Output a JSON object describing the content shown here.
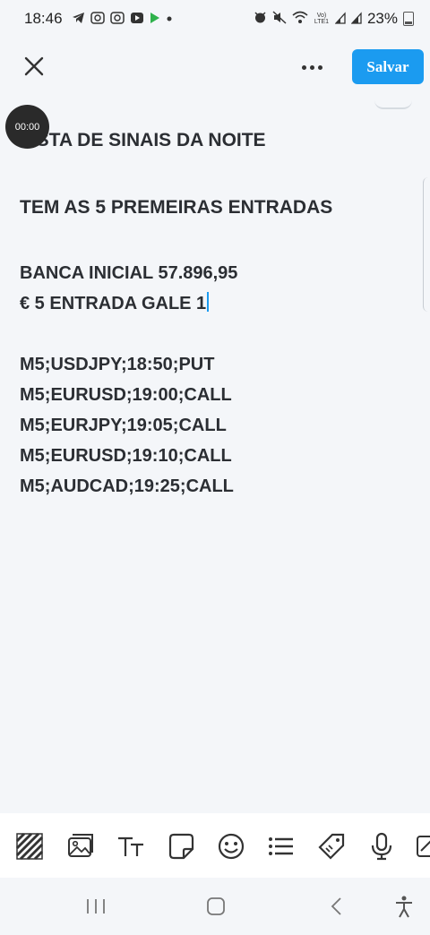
{
  "status_bar": {
    "time": "18:46",
    "battery_percent": "23%",
    "left_icons": [
      "telegram-icon",
      "youtube-icon",
      "youtube-icon",
      "youtube-icon",
      "play-store-icon",
      "dot-icon"
    ],
    "right_icons": [
      "alarm-icon",
      "mute-icon",
      "wifi-icon",
      "volte-icon",
      "signal-icon",
      "signal-icon",
      "battery-icon"
    ],
    "volte_label": "Vo) LTE1"
  },
  "app_bar": {
    "save_label": "Salvar"
  },
  "recording": {
    "timer": "00:00"
  },
  "note": {
    "title": "LISTA DE SINAIS DA NOITE",
    "subtitle": "TEM AS 5 PREMEIRAS ENTRADAS",
    "info_lines": [
      "BANCA INICIAL 57.896,95",
      "€ 5 ENTRADA GALE 1"
    ],
    "signals": [
      "M5;USDJPY;18:50;PUT",
      "M5;EURUSD;19:00;CALL",
      "M5;EURJPY;19:05;CALL",
      "M5;EURUSD;19:10;CALL",
      "M5;AUDCAD;19:25;CALL"
    ]
  },
  "toolbar": {
    "tools": [
      "pattern-icon",
      "image-icon",
      "text-format-icon",
      "sticker-icon",
      "emoji-icon",
      "list-icon",
      "tag-icon",
      "microphone-icon",
      "drawing-icon"
    ]
  },
  "nav_bar": {
    "buttons": [
      "recent-apps-icon",
      "home-icon",
      "back-icon",
      "accessibility-icon"
    ]
  },
  "colors": {
    "accent": "#1b9bf0",
    "background": "#f4f6f9",
    "text": "#2b2e33"
  }
}
